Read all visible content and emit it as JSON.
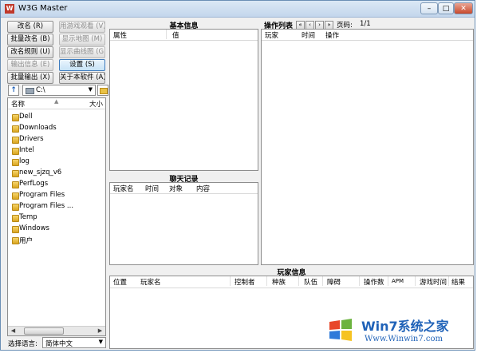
{
  "window": {
    "title": "W3G Master",
    "icon_letter": "W",
    "minimize": "–",
    "maximize": "□",
    "close": "✕"
  },
  "buttons": {
    "rename": "改名 (R)",
    "view_with_game": "用游戏观看 (V)",
    "batch_rename": "批量改名 (B)",
    "show_map": "显示地图 (M)",
    "rename_rules": "改名规则 (U)",
    "show_curve": "显示曲线图 (G)",
    "export_info": "输出信息 (E)",
    "settings": "设置 (S)",
    "batch_export": "批量输出 (X)",
    "about": "关于本软件 (A)"
  },
  "drive": {
    "value": "C:\\"
  },
  "file_list": {
    "col_name": "名称",
    "col_size": "大小",
    "folders": [
      "Dell",
      "Downloads",
      "Drivers",
      "Intel",
      "log",
      "new_sjzq_v6",
      "PerfLogs",
      "Program Files",
      "Program Files ...",
      "Temp",
      "Windows",
      "用户"
    ]
  },
  "language": {
    "label": "选择语言:",
    "value": "简体中文"
  },
  "basic_info": {
    "title": "基本信息",
    "col_attr": "属性",
    "col_value": "值"
  },
  "chat_log": {
    "title": "聊天记录",
    "cols": [
      "玩家名",
      "时间",
      "对象",
      "内容"
    ]
  },
  "operations": {
    "title": "操作列表",
    "page_label": "页码:",
    "page_value": "1/1",
    "cols": [
      "玩家",
      "时间",
      "操作"
    ]
  },
  "player_info": {
    "title": "玩家信息",
    "cols": [
      "位置",
      "玩家名",
      "控制者",
      "种族",
      "队伍",
      "障碍",
      "操作数",
      "APM",
      "游戏时间",
      "结果"
    ]
  },
  "watermark": {
    "brand": "Win7系统之家",
    "url": "Www.Winwin7.com"
  }
}
